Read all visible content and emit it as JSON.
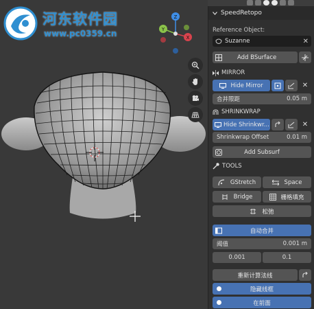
{
  "watermark": {
    "title": "河东软件园",
    "url": "www.pc0359.cn"
  },
  "gizmo": {
    "z": "Z",
    "x": "X",
    "y": "Y"
  },
  "panel": {
    "title": "SpeedRetopo",
    "reference_label": "Reference Object:",
    "reference_value": "Suzanne",
    "add_bsurface": "Add BSurface",
    "mirror": {
      "title": "MIRROR",
      "hide_label": "Hide Mirror",
      "merge_label": "合并限距",
      "merge_value": "0.05 m"
    },
    "shrinkwrap": {
      "title": "SHRINKWRAP",
      "hide_label": "Hide Shrinkwr...",
      "offset_label": "Shrinkwrap Offset",
      "offset_value": "0.01 m"
    },
    "add_subsurf": "Add Subsurf",
    "tools": {
      "title": "TOOLS",
      "gstretch": "GStretch",
      "space": "Space",
      "bridge": "Bridge",
      "grid_fill": "栅格填充",
      "relax": "松弛"
    },
    "auto_merge": {
      "label": "自动合并",
      "threshold_label": "阈值",
      "threshold_value": "0.001 m",
      "min_value": "0.001",
      "max_value": "0.1"
    },
    "recalc_normals": "重新计算法线",
    "hide_wire": "隐藏线框",
    "in_front": "在前面"
  },
  "colors": {
    "accent": "#4772b3",
    "watermark": "#2f8fd1",
    "axis_x": "#d8434d",
    "axis_y": "#8bc34a",
    "axis_z": "#3f8ee6"
  }
}
